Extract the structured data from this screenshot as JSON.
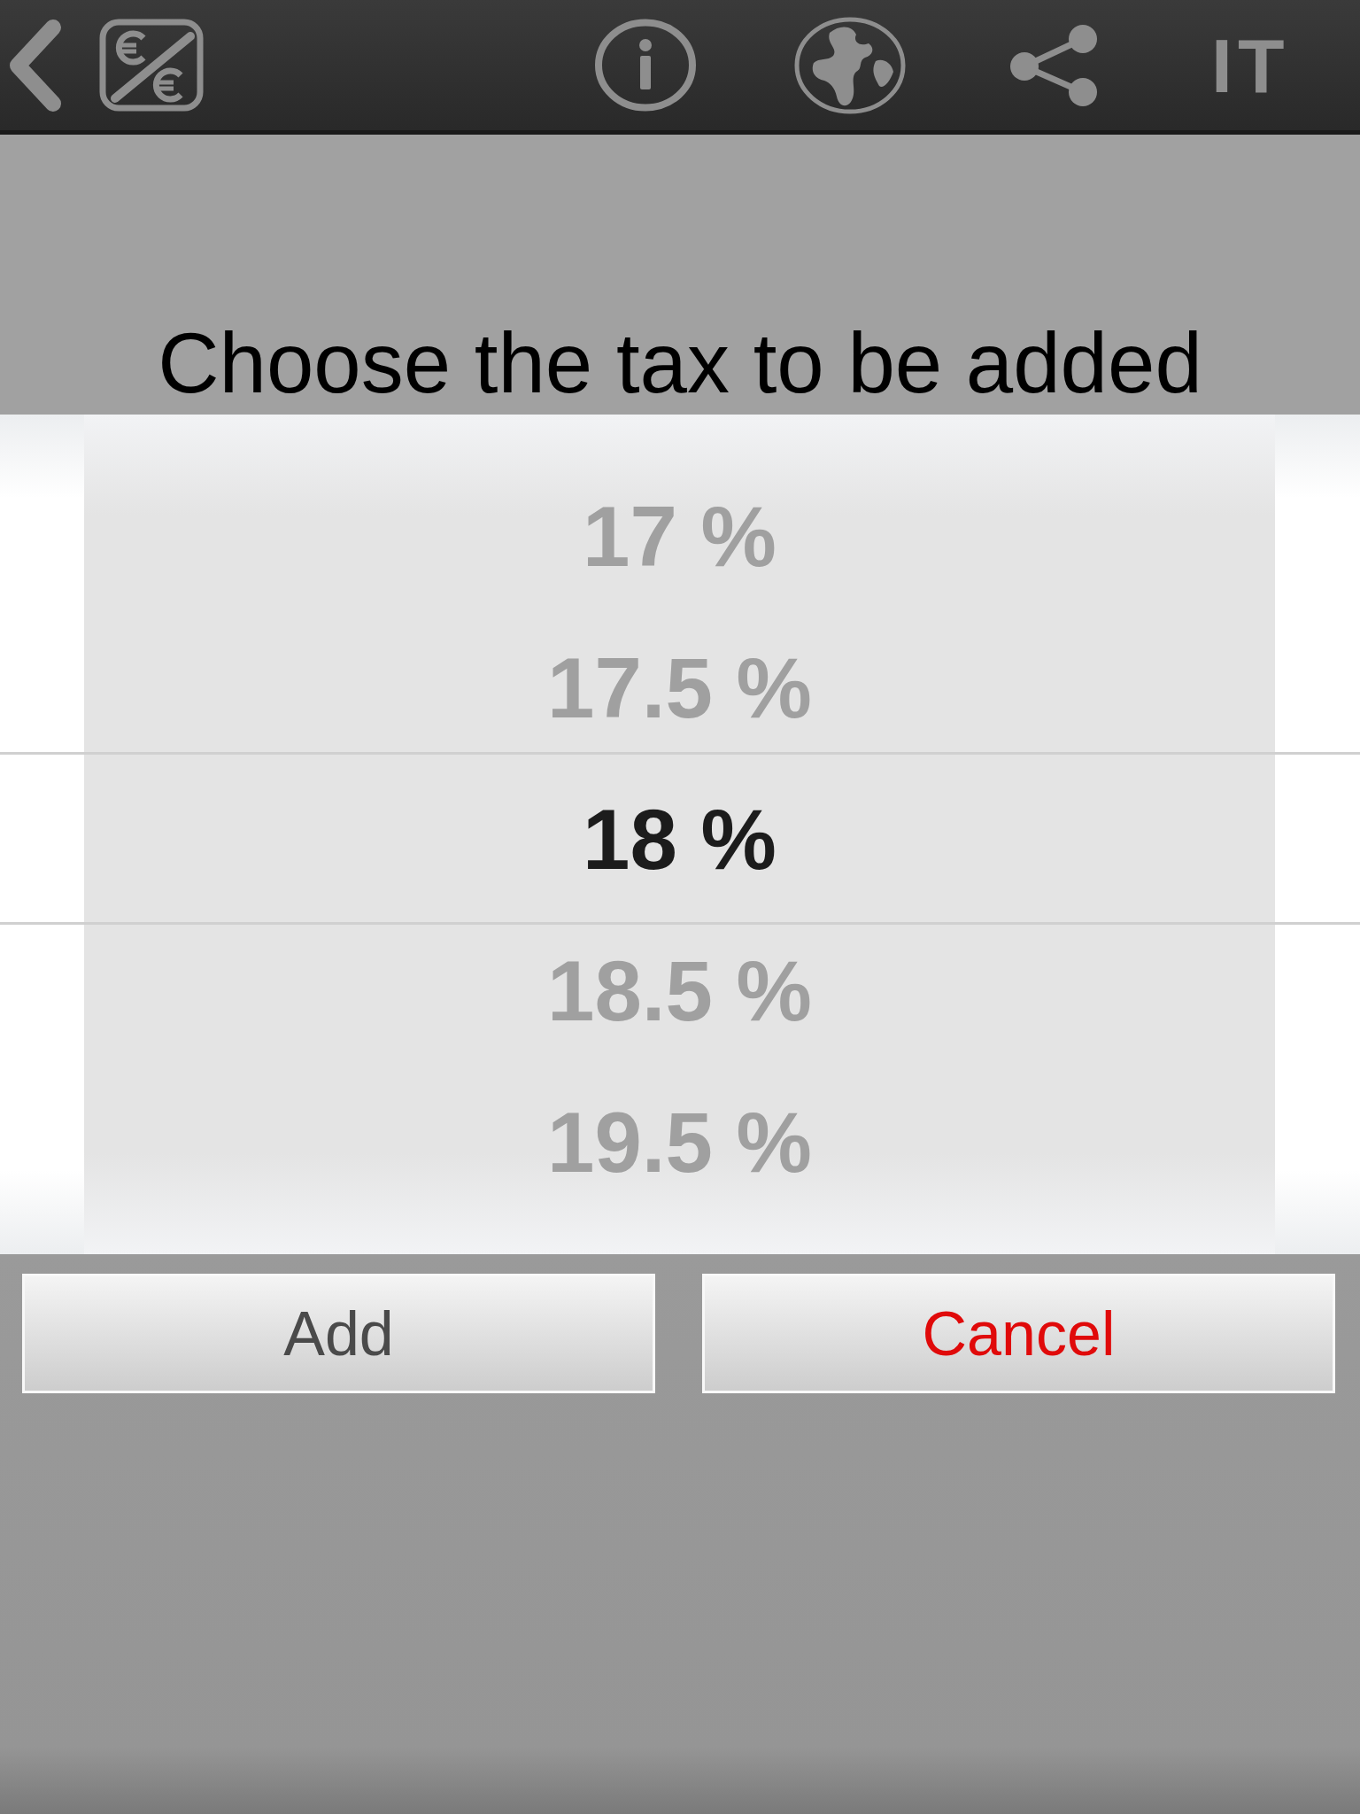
{
  "toolbar": {
    "language": "IT"
  },
  "dialog": {
    "title": "Choose the tax to be added",
    "picker": {
      "options": [
        {
          "label": "17 %",
          "selected": false
        },
        {
          "label": "17.5 %",
          "selected": false
        },
        {
          "label": "18 %",
          "selected": true
        },
        {
          "label": "18.5 %",
          "selected": false
        },
        {
          "label": "19.5 %",
          "selected": false
        }
      ]
    },
    "buttons": [
      {
        "label": "Add",
        "kind": "confirm"
      },
      {
        "label": "Cancel",
        "kind": "cancel"
      }
    ]
  }
}
